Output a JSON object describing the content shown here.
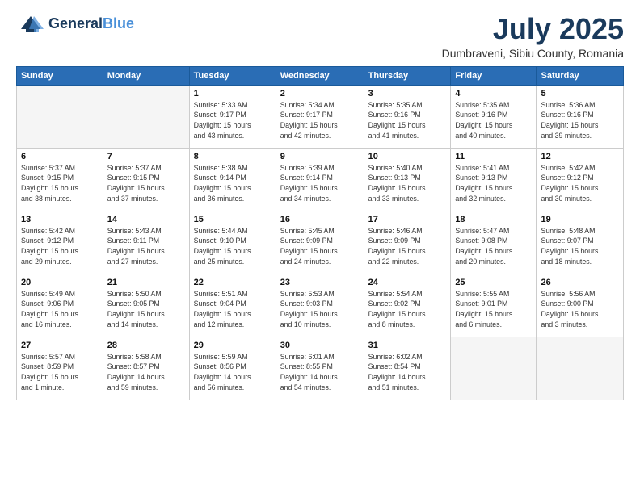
{
  "logo": {
    "line1a": "General",
    "line1b": "Blue",
    "tagline": ""
  },
  "title": "July 2025",
  "location": "Dumbraveni, Sibiu County, Romania",
  "headers": [
    "Sunday",
    "Monday",
    "Tuesday",
    "Wednesday",
    "Thursday",
    "Friday",
    "Saturday"
  ],
  "weeks": [
    [
      {
        "day": "",
        "info": ""
      },
      {
        "day": "",
        "info": ""
      },
      {
        "day": "1",
        "info": "Sunrise: 5:33 AM\nSunset: 9:17 PM\nDaylight: 15 hours\nand 43 minutes."
      },
      {
        "day": "2",
        "info": "Sunrise: 5:34 AM\nSunset: 9:17 PM\nDaylight: 15 hours\nand 42 minutes."
      },
      {
        "day": "3",
        "info": "Sunrise: 5:35 AM\nSunset: 9:16 PM\nDaylight: 15 hours\nand 41 minutes."
      },
      {
        "day": "4",
        "info": "Sunrise: 5:35 AM\nSunset: 9:16 PM\nDaylight: 15 hours\nand 40 minutes."
      },
      {
        "day": "5",
        "info": "Sunrise: 5:36 AM\nSunset: 9:16 PM\nDaylight: 15 hours\nand 39 minutes."
      }
    ],
    [
      {
        "day": "6",
        "info": "Sunrise: 5:37 AM\nSunset: 9:15 PM\nDaylight: 15 hours\nand 38 minutes."
      },
      {
        "day": "7",
        "info": "Sunrise: 5:37 AM\nSunset: 9:15 PM\nDaylight: 15 hours\nand 37 minutes."
      },
      {
        "day": "8",
        "info": "Sunrise: 5:38 AM\nSunset: 9:14 PM\nDaylight: 15 hours\nand 36 minutes."
      },
      {
        "day": "9",
        "info": "Sunrise: 5:39 AM\nSunset: 9:14 PM\nDaylight: 15 hours\nand 34 minutes."
      },
      {
        "day": "10",
        "info": "Sunrise: 5:40 AM\nSunset: 9:13 PM\nDaylight: 15 hours\nand 33 minutes."
      },
      {
        "day": "11",
        "info": "Sunrise: 5:41 AM\nSunset: 9:13 PM\nDaylight: 15 hours\nand 32 minutes."
      },
      {
        "day": "12",
        "info": "Sunrise: 5:42 AM\nSunset: 9:12 PM\nDaylight: 15 hours\nand 30 minutes."
      }
    ],
    [
      {
        "day": "13",
        "info": "Sunrise: 5:42 AM\nSunset: 9:12 PM\nDaylight: 15 hours\nand 29 minutes."
      },
      {
        "day": "14",
        "info": "Sunrise: 5:43 AM\nSunset: 9:11 PM\nDaylight: 15 hours\nand 27 minutes."
      },
      {
        "day": "15",
        "info": "Sunrise: 5:44 AM\nSunset: 9:10 PM\nDaylight: 15 hours\nand 25 minutes."
      },
      {
        "day": "16",
        "info": "Sunrise: 5:45 AM\nSunset: 9:09 PM\nDaylight: 15 hours\nand 24 minutes."
      },
      {
        "day": "17",
        "info": "Sunrise: 5:46 AM\nSunset: 9:09 PM\nDaylight: 15 hours\nand 22 minutes."
      },
      {
        "day": "18",
        "info": "Sunrise: 5:47 AM\nSunset: 9:08 PM\nDaylight: 15 hours\nand 20 minutes."
      },
      {
        "day": "19",
        "info": "Sunrise: 5:48 AM\nSunset: 9:07 PM\nDaylight: 15 hours\nand 18 minutes."
      }
    ],
    [
      {
        "day": "20",
        "info": "Sunrise: 5:49 AM\nSunset: 9:06 PM\nDaylight: 15 hours\nand 16 minutes."
      },
      {
        "day": "21",
        "info": "Sunrise: 5:50 AM\nSunset: 9:05 PM\nDaylight: 15 hours\nand 14 minutes."
      },
      {
        "day": "22",
        "info": "Sunrise: 5:51 AM\nSunset: 9:04 PM\nDaylight: 15 hours\nand 12 minutes."
      },
      {
        "day": "23",
        "info": "Sunrise: 5:53 AM\nSunset: 9:03 PM\nDaylight: 15 hours\nand 10 minutes."
      },
      {
        "day": "24",
        "info": "Sunrise: 5:54 AM\nSunset: 9:02 PM\nDaylight: 15 hours\nand 8 minutes."
      },
      {
        "day": "25",
        "info": "Sunrise: 5:55 AM\nSunset: 9:01 PM\nDaylight: 15 hours\nand 6 minutes."
      },
      {
        "day": "26",
        "info": "Sunrise: 5:56 AM\nSunset: 9:00 PM\nDaylight: 15 hours\nand 3 minutes."
      }
    ],
    [
      {
        "day": "27",
        "info": "Sunrise: 5:57 AM\nSunset: 8:59 PM\nDaylight: 15 hours\nand 1 minute."
      },
      {
        "day": "28",
        "info": "Sunrise: 5:58 AM\nSunset: 8:57 PM\nDaylight: 14 hours\nand 59 minutes."
      },
      {
        "day": "29",
        "info": "Sunrise: 5:59 AM\nSunset: 8:56 PM\nDaylight: 14 hours\nand 56 minutes."
      },
      {
        "day": "30",
        "info": "Sunrise: 6:01 AM\nSunset: 8:55 PM\nDaylight: 14 hours\nand 54 minutes."
      },
      {
        "day": "31",
        "info": "Sunrise: 6:02 AM\nSunset: 8:54 PM\nDaylight: 14 hours\nand 51 minutes."
      },
      {
        "day": "",
        "info": ""
      },
      {
        "day": "",
        "info": ""
      }
    ]
  ]
}
